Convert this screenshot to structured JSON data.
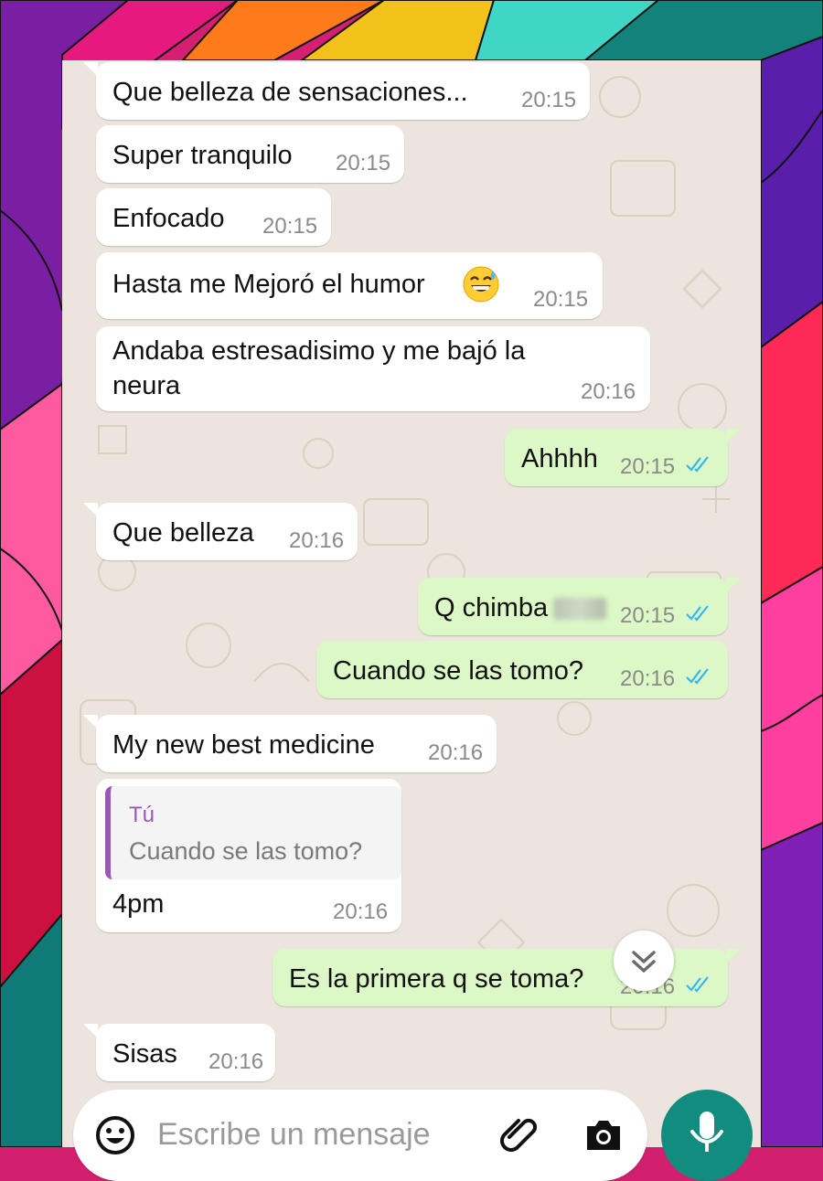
{
  "chat": {
    "messages": [
      {
        "dir": "in",
        "text": "Que belleza de sensaciones...",
        "time": "20:15"
      },
      {
        "dir": "in",
        "text": "Super tranquilo",
        "time": "20:15"
      },
      {
        "dir": "in",
        "text": "Enfocado",
        "time": "20:15"
      },
      {
        "dir": "in",
        "text": "Hasta me Mejoró el humor",
        "time": "20:15",
        "emoji": "grinning-sweat-emoji"
      },
      {
        "dir": "in",
        "text": "Andaba estresadisimo y me bajó la neura",
        "time": "20:16"
      },
      {
        "dir": "out",
        "text": "Ahhhh",
        "time": "20:15",
        "status": "read"
      },
      {
        "dir": "in",
        "text": "Que belleza",
        "time": "20:16"
      },
      {
        "dir": "out",
        "text": "Q chimba",
        "time": "20:15",
        "status": "read",
        "blurred_suffix": true
      },
      {
        "dir": "out",
        "text": "Cuando se las tomo?",
        "time": "20:16",
        "status": "read"
      },
      {
        "dir": "in",
        "text": "My new best medicine",
        "time": "20:16"
      },
      {
        "dir": "in",
        "text": "4pm",
        "time": "20:16",
        "quote": {
          "author": "Tú",
          "text": "Cuando se las tomo?"
        }
      },
      {
        "dir": "out",
        "text": "Es la primera q se toma?",
        "time": "20:16",
        "status": "read"
      },
      {
        "dir": "in",
        "text": "Sisas",
        "time": "20:16"
      }
    ]
  },
  "input_bar": {
    "placeholder": "Escribe un mensaje",
    "icons": [
      "emoji-icon",
      "attach-icon",
      "camera-icon",
      "mic-icon"
    ]
  },
  "colors": {
    "chat_background": "#ece5dd",
    "incoming_bubble": "#ffffff",
    "outgoing_bubble": "#dcf8c6",
    "read_ticks": "#34b7f1",
    "quote_accent": "#9b59b6",
    "mic_button": "#128c7e"
  }
}
